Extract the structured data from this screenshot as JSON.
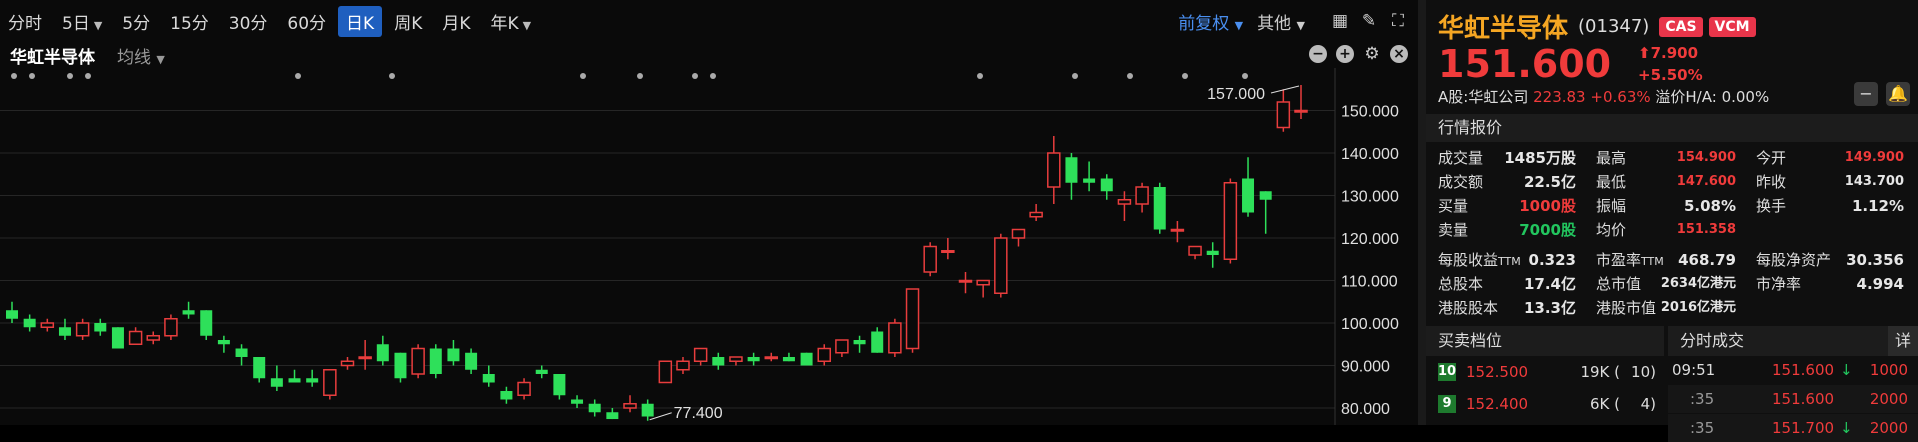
{
  "toolbar": {
    "periods": [
      "分时",
      "5日",
      "5分",
      "15分",
      "30分",
      "60分",
      "日K",
      "周K",
      "月K",
      "年K"
    ],
    "active": "日K",
    "adjust": "前复权",
    "other": "其他"
  },
  "subbar": {
    "name": "华虹半导体",
    "ma": "均线"
  },
  "chart_data": {
    "type": "candlestick",
    "ylim": [
      76,
      160
    ],
    "y_ticks": [
      "150.000",
      "140.000",
      "130.000",
      "120.000",
      "110.000",
      "100.000",
      "90.000",
      "80.000"
    ],
    "high_label": "157.000",
    "low_label": "77.400",
    "candles": [
      [
        103,
        101,
        105,
        100
      ],
      [
        101,
        99,
        102,
        98
      ],
      [
        99,
        100,
        101,
        98
      ],
      [
        99,
        97,
        101,
        96
      ],
      [
        97,
        100,
        101,
        96
      ],
      [
        100,
        98,
        101,
        97
      ],
      [
        99,
        94,
        99,
        94
      ],
      [
        95,
        98,
        99,
        95
      ],
      [
        96,
        97,
        98,
        95
      ],
      [
        97,
        101,
        102,
        96
      ],
      [
        103,
        102,
        105,
        101
      ],
      [
        103,
        97,
        103,
        96
      ],
      [
        96,
        95,
        97,
        93
      ],
      [
        94,
        92,
        95,
        90
      ],
      [
        92,
        87,
        92,
        86
      ],
      [
        87,
        85,
        90,
        84
      ],
      [
        87,
        86,
        89,
        86
      ],
      [
        87,
        86,
        89,
        85
      ],
      [
        83,
        89,
        89,
        82
      ],
      [
        90,
        91,
        92,
        89
      ],
      [
        92,
        92,
        96,
        89
      ],
      [
        95,
        91,
        97,
        90
      ],
      [
        93,
        87,
        93,
        86
      ],
      [
        88,
        94,
        95,
        87
      ],
      [
        94,
        88,
        95,
        87
      ],
      [
        94,
        91,
        96,
        90
      ],
      [
        93,
        89,
        94,
        88
      ],
      [
        88,
        86,
        90,
        85
      ],
      [
        84,
        82,
        85,
        81
      ],
      [
        83,
        86,
        87,
        82
      ],
      [
        89,
        88,
        90,
        87
      ],
      [
        88,
        83,
        88,
        82
      ],
      [
        82,
        81,
        83,
        80
      ],
      [
        81,
        79,
        82,
        78
      ],
      [
        79,
        77.4,
        80,
        77.4
      ],
      [
        80,
        81,
        83,
        79
      ],
      [
        81,
        78,
        82,
        77
      ],
      [
        86,
        91,
        91,
        86
      ],
      [
        89,
        91,
        92,
        88
      ],
      [
        91,
        94,
        94,
        90
      ],
      [
        92,
        90,
        93,
        89
      ],
      [
        91,
        92,
        92,
        90
      ],
      [
        92,
        91,
        93,
        90
      ],
      [
        92,
        92,
        93,
        91
      ],
      [
        92,
        91,
        93,
        91
      ],
      [
        93,
        90,
        93,
        90
      ],
      [
        91,
        94,
        95,
        90
      ],
      [
        93,
        96,
        96,
        92
      ],
      [
        96,
        95,
        97,
        93
      ],
      [
        98,
        93,
        99,
        93
      ],
      [
        93,
        100,
        101,
        92
      ],
      [
        94,
        108,
        108,
        93
      ],
      [
        112,
        118,
        119,
        111
      ],
      [
        117,
        117,
        120,
        115
      ],
      [
        110,
        110,
        112,
        107
      ],
      [
        109,
        110,
        110,
        106
      ],
      [
        107,
        120,
        121,
        106
      ],
      [
        120,
        122,
        122,
        118
      ],
      [
        125,
        126,
        128,
        124
      ],
      [
        132,
        140,
        144,
        128
      ],
      [
        139,
        133,
        140,
        129
      ],
      [
        134,
        133,
        138,
        131
      ],
      [
        134,
        131,
        135,
        129
      ],
      [
        128,
        129,
        131,
        124
      ],
      [
        128,
        132,
        133,
        126
      ],
      [
        132,
        122,
        133,
        121
      ],
      [
        122,
        122,
        124,
        119
      ],
      [
        116,
        118,
        118,
        115
      ],
      [
        117,
        116,
        119,
        113
      ],
      [
        115,
        133,
        134,
        114
      ],
      [
        134,
        126,
        139,
        125
      ],
      [
        131,
        129,
        131,
        121
      ],
      [
        146,
        152,
        155,
        145
      ],
      [
        150,
        150,
        156,
        148
      ]
    ]
  },
  "quote": {
    "name": "华虹半导体",
    "code": "(01347)",
    "tags": [
      "CAS",
      "VCM"
    ],
    "price": "151.600",
    "change": "7.900",
    "change_pct": "+5.50%",
    "ashare_label": "A股:华虹公司",
    "ashare_price": "223.83",
    "ashare_pct": "+0.63%",
    "premium_label": "溢价H/A:",
    "premium": "0.00%",
    "section_title": "行情报价",
    "rows": [
      [
        [
          "成交量",
          "1485万股",
          "white"
        ],
        [
          "最高",
          "154.900",
          "red"
        ],
        [
          "今开",
          "149.900",
          "red"
        ]
      ],
      [
        [
          "成交额",
          "22.5亿",
          "white"
        ],
        [
          "最低",
          "147.600",
          "red"
        ],
        [
          "昨收",
          "143.700",
          "white"
        ]
      ],
      [
        [
          "买量",
          "1000股",
          "red"
        ],
        [
          "振幅",
          "5.08%",
          "white"
        ],
        [
          "换手",
          "1.12%",
          "white"
        ]
      ],
      [
        [
          "卖量",
          "7000股",
          "green"
        ],
        [
          "均价",
          "151.358",
          "red"
        ],
        [
          "",
          "",
          " "
        ]
      ],
      [
        [
          "每股收益TTM",
          "0.323",
          "white"
        ],
        [
          "市盈率TTM",
          "468.79",
          "white"
        ],
        [
          "每股净资产",
          "30.356",
          "white"
        ]
      ],
      [
        [
          "总股本",
          "17.4亿",
          "white"
        ],
        [
          "总市值",
          "2634亿港元",
          "white"
        ],
        [
          "市净率",
          "4.994",
          "white"
        ]
      ],
      [
        [
          "港股股本",
          "13.3亿",
          "white"
        ],
        [
          "港股市值",
          "2016亿港元",
          "white"
        ],
        [
          "",
          "",
          " "
        ]
      ]
    ],
    "book_title": "买卖档位",
    "tick_title": "分时成交",
    "tick_more": "详",
    "book": [
      {
        "level": "10",
        "price": "152.500",
        "vol": "19K (",
        "cnt": "10)"
      },
      {
        "level": "9",
        "price": "152.400",
        "vol": "6K (",
        "cnt": "4)"
      }
    ],
    "ticks": [
      {
        "time": "09:51",
        "price": "151.600",
        "dir": "↓",
        "vol": "1000"
      },
      {
        "time": ":35",
        "price": "151.600",
        "dir": "",
        "vol": "2000"
      },
      {
        "time": ":35",
        "price": "151.700",
        "dir": "↓",
        "vol": "2000"
      }
    ]
  }
}
